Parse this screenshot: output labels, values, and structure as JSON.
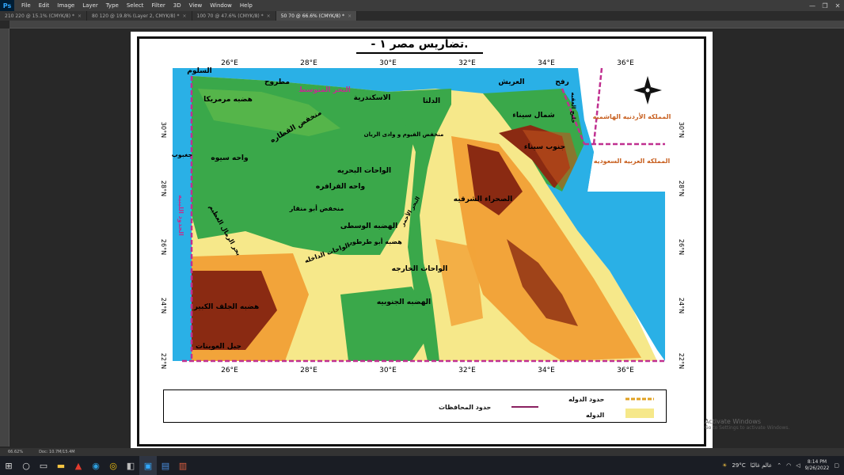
{
  "app": {
    "logo": "Ps"
  },
  "menu": [
    "File",
    "Edit",
    "Image",
    "Layer",
    "Type",
    "Select",
    "Filter",
    "3D",
    "View",
    "Window",
    "Help"
  ],
  "window_controls": [
    "—",
    "❐",
    "✕"
  ],
  "tabs": [
    {
      "label": "210 220 @ 15.1% (CMYK/8) *"
    },
    {
      "label": "80 120 @ 19.8% (Layer 2, CMYK/8) *"
    },
    {
      "label": "100 70 @ 47.6% (CMYK/8) *"
    },
    {
      "label": "50 70 @ 66.6% (CMYK/8) *"
    }
  ],
  "document": {
    "title": "- تضاريس مصر ١.",
    "longitude_labels": [
      "26°E",
      "28°E",
      "30°E",
      "32°E",
      "34°E",
      "36°E"
    ],
    "latitude_labels": [
      "30°N",
      "28°N",
      "26°N",
      "24°N",
      "22°N"
    ],
    "place_labels": {
      "sallum": "السلوم",
      "marsa_matruh": "مطروح",
      "mediterranean": "البحر المتوسط",
      "alexandria": "الاسكندرية",
      "delta": "الدلتا",
      "rafah": "رفح",
      "arish": "العريش",
      "marmarica": "هضبه مرمريكا",
      "qattara": "منخفض القطاره",
      "fayoum": "منخفض الفيوم و وادى الريان",
      "north_sinai": "شمال سيناء",
      "south_sinai": "جنوب سيناء",
      "aqaba": "خليج العقبه",
      "jordan": "المملكه الأردنيه الهاشميه",
      "saudi": "المملكه العربيه السعوديه",
      "siwa": "واحه سيوه",
      "jaghbub": "جغبوب",
      "bahariya": "الواحات البحريه",
      "farafra": "واحه الفرافره",
      "eastern_desert": "الصحراء الشرقيه",
      "libya_border": "الحدود الليبيه",
      "great_sand_sea": "بحر الرمال العظيم",
      "abu_minqar": "منخفض أبو منقار",
      "central_plateau": "الهضبه الوسطى",
      "abu_tartur": "هضبه أبو طرطور",
      "dakhla": "الواحات الداخله",
      "kharga": "الواحات الخارجه",
      "southern_plateau": "الهضبه الجنوبيه",
      "gilf_kebir": "هضبه الجلف الكبير",
      "uweinat": "جبل العوينات",
      "red_sea_label": "البحر الأحمر"
    },
    "legend": {
      "country_border": "حدود الدوله",
      "governorate_border": "حدود المحافظات",
      "state": "الدوله"
    }
  },
  "status": {
    "zoom": "66.62%",
    "doc_size": "Doc: 10.7M/15.4M"
  },
  "watermark": {
    "line1": "Activate Windows",
    "line2": "Go to Settings to activate Windows."
  },
  "taskbar": {
    "weather": "29°C",
    "news": "عالم غالبًا",
    "time": "8:14 PM",
    "date": "9/26/2022"
  },
  "colors": {
    "sea": "#2ab0e6",
    "lowland": "#3aa84a",
    "midland": "#f6e88a",
    "upland": "#f2a43a",
    "highland": "#8a2a12",
    "border": "#c03090"
  }
}
